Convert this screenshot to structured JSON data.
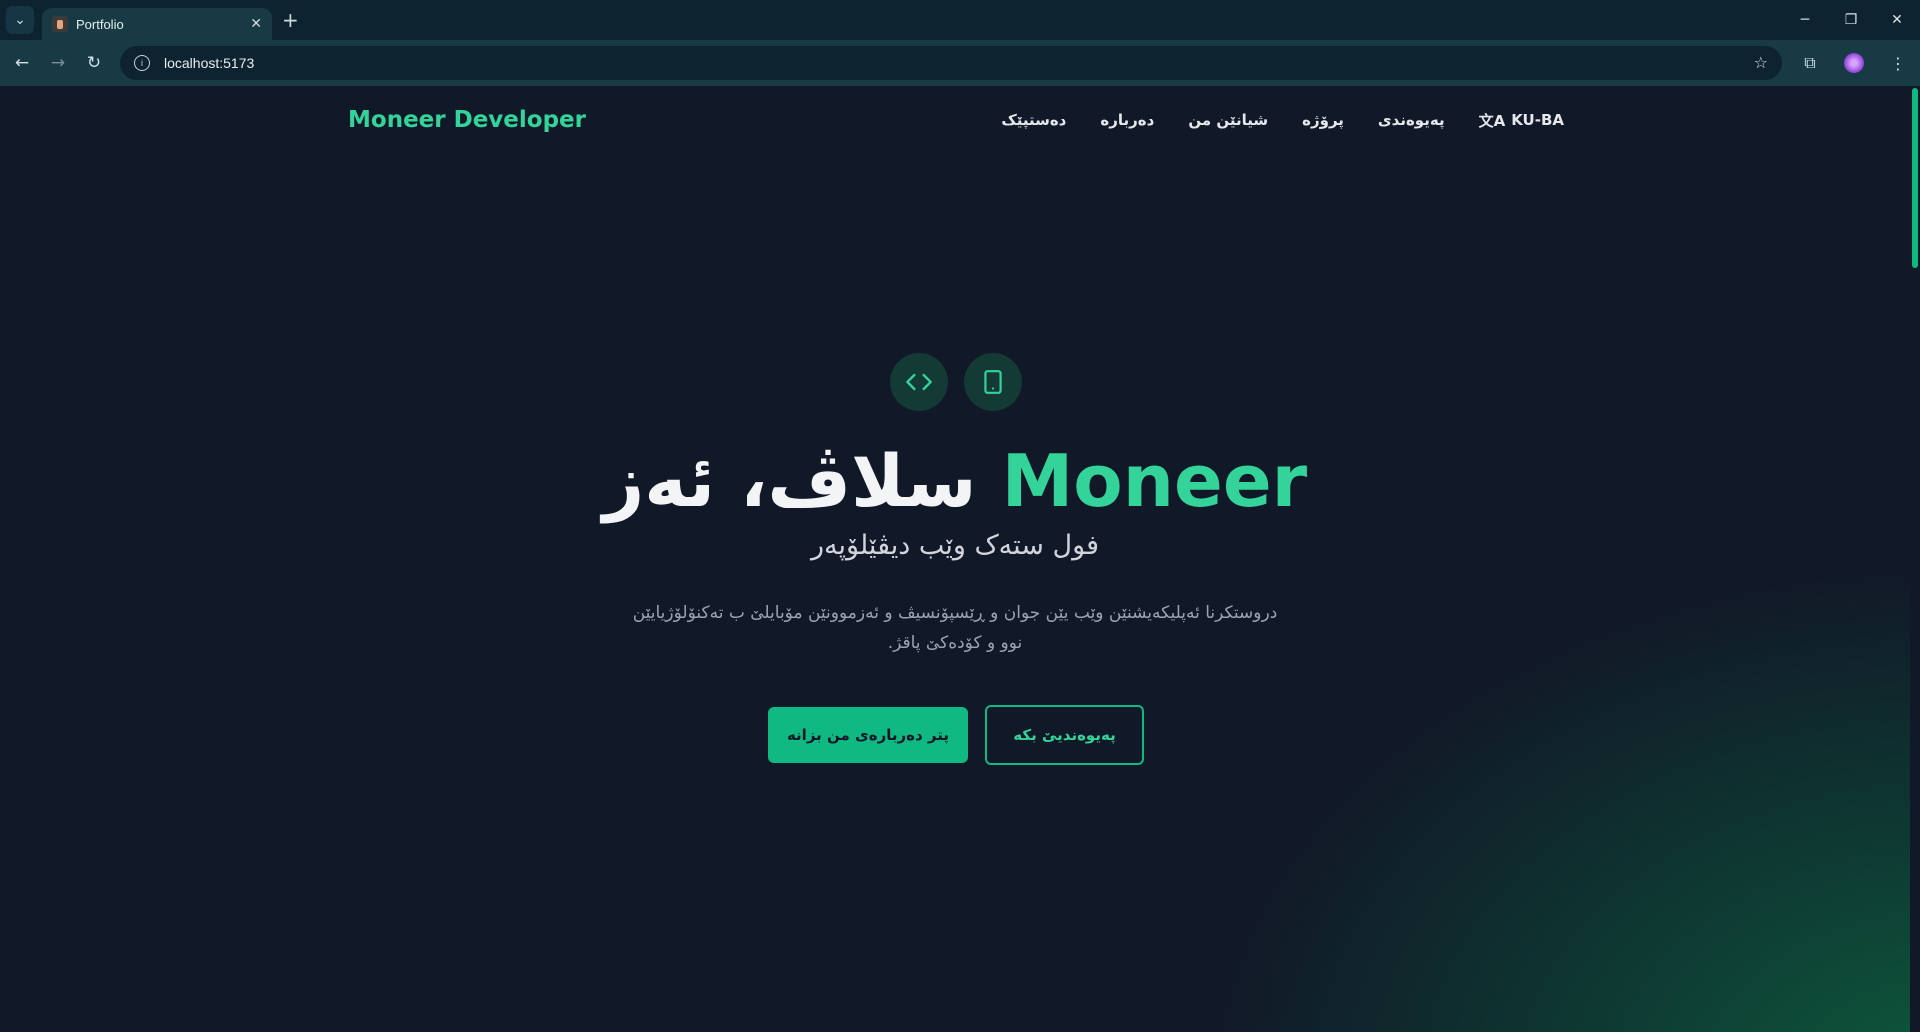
{
  "browser": {
    "tab_title": "Portfolio",
    "url": "localhost:5173"
  },
  "navbar": {
    "brand": "Moneer Developer",
    "links": [
      "دەستپێک",
      "دەربارە",
      "شیانێن من",
      "پرۆژە",
      "پەیوەندی"
    ],
    "lang_label": "KU-BA"
  },
  "hero": {
    "title_accent": "Moneer",
    "title_rest": "سلاڤ، ئەز",
    "subtitle": "فول ستەک وێب دیڤێلۆپەر",
    "description": "دروستکرنا ئەپلیکەیشنێن وێب یێن جوان و ڕێسپۆنسیڤ و ئەزموونێن مۆبایلێ ب تەکنۆلۆژیایێن نوو و کۆدەکێ پاقژ.",
    "primary_button": "پتر دەربارەی من بزانە",
    "secondary_button": "پەیوەندیێ بکە"
  },
  "colors": {
    "accent": "#34d399",
    "button": "#10b981",
    "background": "#111827"
  }
}
